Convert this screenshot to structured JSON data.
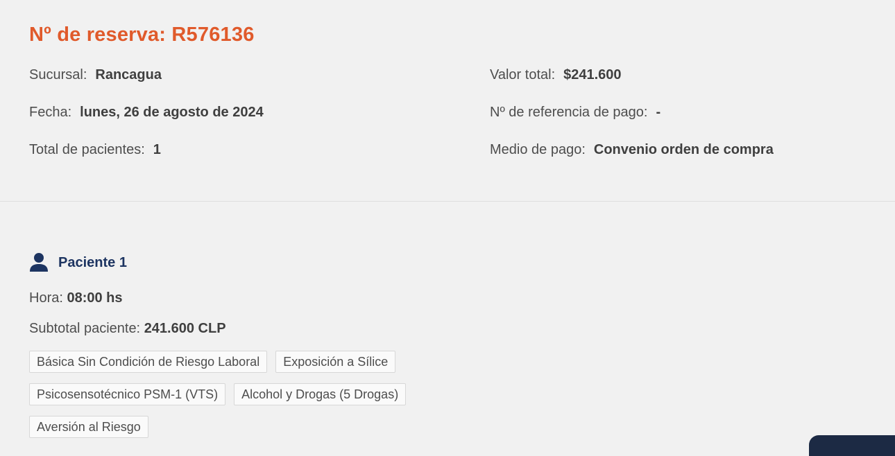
{
  "booking": {
    "title": "Nº de reserva: R576136",
    "left": [
      {
        "label": "Sucursal:",
        "value": "Rancagua"
      },
      {
        "label": "Fecha:",
        "value": "lunes, 26 de agosto de 2024"
      },
      {
        "label": "Total de pacientes:",
        "value": "1"
      }
    ],
    "right": [
      {
        "label": "Valor total:",
        "value": "$241.600"
      },
      {
        "label": "Nº de referencia de pago:",
        "value": "-"
      },
      {
        "label": "Medio de pago:",
        "value": "Convenio orden de compra"
      }
    ]
  },
  "patient": {
    "icon": "person-icon",
    "title": "Paciente 1",
    "hora_label": "Hora:",
    "hora_value": "08:00 hs",
    "subtotal_label": "Subtotal paciente:",
    "subtotal_value": "241.600 CLP",
    "tags": [
      "Básica Sin Condición de Riesgo Laboral",
      "Exposición a Sílice",
      "Psicosensotécnico PSM-1 (VTS)",
      "Alcohol y Drogas (5 Drogas)",
      "Aversión al Riesgo"
    ]
  },
  "colors": {
    "accent": "#e05a2b",
    "patient_title": "#1d3461",
    "background": "#f1f1f1"
  }
}
